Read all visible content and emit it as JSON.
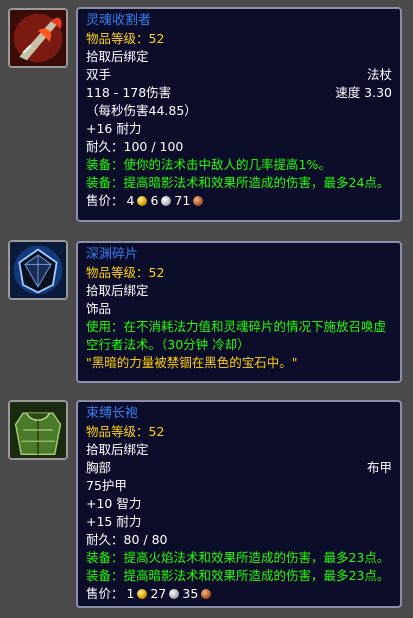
{
  "items": [
    {
      "icon": "red-scythe-weapon-icon",
      "name": "灵魂收割者",
      "item_level": "物品等级：52",
      "bind": "拾取后绑定",
      "slot": "双手",
      "type": "法杖",
      "damage": "118 - 178伤害",
      "speed": "速度 3.30",
      "dps": "（每秒伤害44.85）",
      "stat1": "+16 耐力",
      "durability": "耐久：100 / 100",
      "equip1": "装备：使你的法术击中敌人的几率提高1%。",
      "equip2": "装备：提高暗影法术和效果所造成的伤害，最多24点。",
      "sell_label": "售价：",
      "gold": "4",
      "silver": "6",
      "copper": "71"
    },
    {
      "icon": "blue-gem-shard-icon",
      "name": "深渊碎片",
      "item_level": "物品等级：52",
      "bind": "拾取后绑定",
      "slot": "饰品",
      "use": "使用：在不消耗法力值和灵魂碎片的情况下施放召唤虚空行者法术。（30分钟 冷却）",
      "flavor": "\"黑暗的力量被禁锢在黑色的宝石中。\""
    },
    {
      "icon": "green-robe-icon",
      "name": "束缚长袍",
      "item_level": "物品等级：52",
      "bind": "拾取后绑定",
      "slot": "胸部",
      "type": "布甲",
      "armor": "75护甲",
      "stat1": "+10 智力",
      "stat2": "+15 耐力",
      "durability": "耐久：80 / 80",
      "equip1": "装备：提高火焰法术和效果所造成的伤害，最多23点。",
      "equip2": "装备：提高暗影法术和效果所造成的伤害，最多23点。",
      "sell_label": "售价：",
      "gold": "1",
      "silver": "27",
      "copper": "35"
    }
  ]
}
